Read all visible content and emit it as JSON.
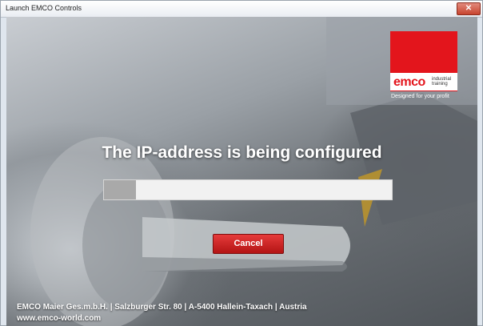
{
  "window": {
    "title": "Launch EMCO Controls",
    "close_glyph": "✕"
  },
  "logo": {
    "word": "emco",
    "sub": "industrial training",
    "tagline": "Designed for your profit"
  },
  "status": {
    "heading": "The IP-address is being configured",
    "progress_fraction": 0.11
  },
  "actions": {
    "cancel_label": "Cancel"
  },
  "footer": {
    "company": "EMCO Maier Ges.m.b.H. | Salzburger Str. 80 | A-5400 Hallein-Taxach | Austria",
    "website": "www.emco-world.com"
  },
  "colors": {
    "brand_red": "#e3151c",
    "progress_fill": "#a9a9a9",
    "button_red": "#c81e1e"
  },
  "icons": {
    "close": "close-icon"
  }
}
